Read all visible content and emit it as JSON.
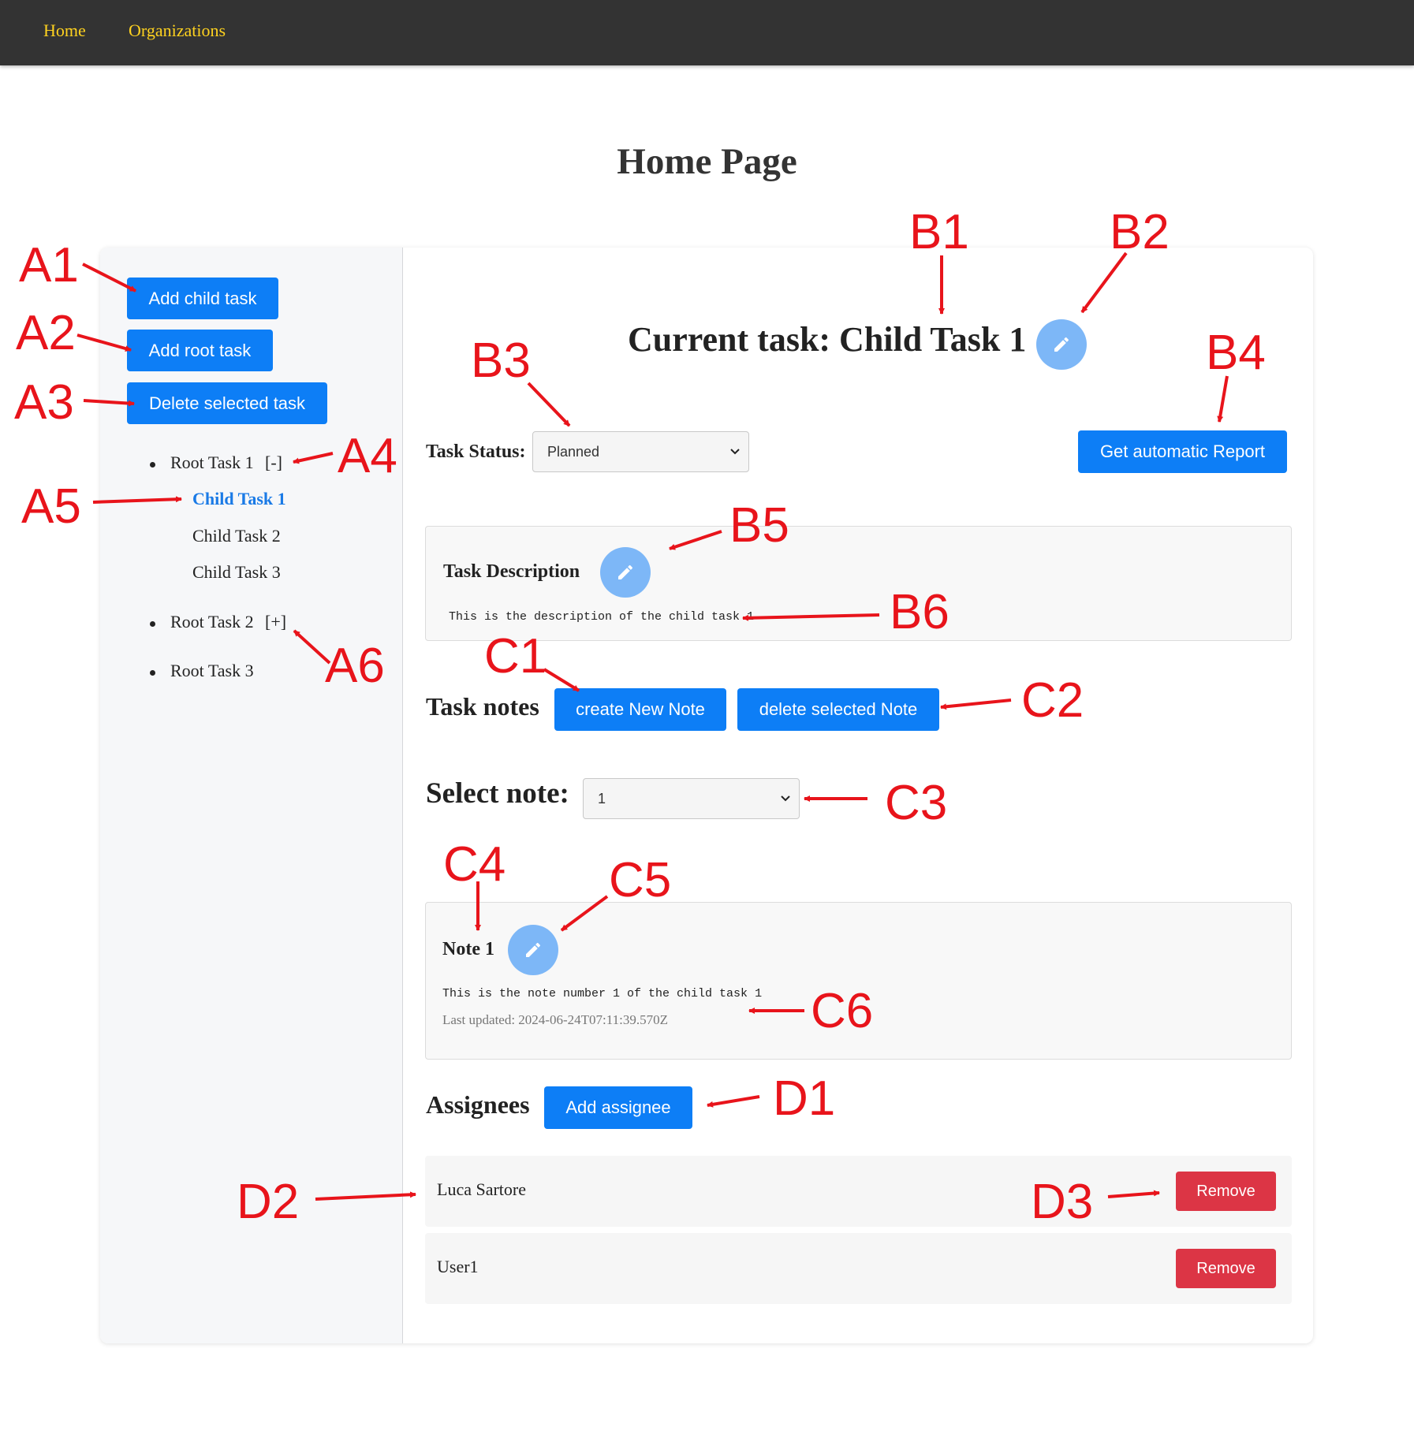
{
  "nav": {
    "home": "Home",
    "organizations": "Organizations"
  },
  "page_title": "Home Page",
  "sidebar": {
    "add_child": "Add child task",
    "add_root": "Add root task",
    "delete_selected": "Delete selected task",
    "tree": {
      "root1": "Root Task 1",
      "root1_toggle": "[-]",
      "child1": "Child Task 1",
      "child2": "Child Task 2",
      "child3": "Child Task 3",
      "root2": "Root Task 2",
      "root2_toggle": "[+]",
      "root3": "Root Task 3"
    }
  },
  "main": {
    "current_task": "Current task: Child Task 1",
    "status_label": "Task Status:",
    "status_value": "Planned",
    "report_button": "Get automatic Report",
    "description_title": "Task Description",
    "description_text": "This is the description of the child task 1",
    "notes_heading": "Task notes",
    "create_note": "create New Note",
    "delete_note": "delete selected Note",
    "select_note_label": "Select note:",
    "select_note_value": "1",
    "note_title": "Note 1",
    "note_text": "This is the note number 1 of the child task 1",
    "note_updated": "Last updated: 2024-06-24T07:11:39.570Z",
    "assignees_heading": "Assignees",
    "add_assignee": "Add assignee",
    "assignees": [
      {
        "name": "Luca Sartore",
        "remove": "Remove"
      },
      {
        "name": "User1",
        "remove": "Remove"
      }
    ]
  },
  "annotations": {
    "A1": "A1",
    "A2": "A2",
    "A3": "A3",
    "A4": "A4",
    "A5": "A5",
    "A6": "A6",
    "B1": "B1",
    "B2": "B2",
    "B3": "B3",
    "B4": "B4",
    "B5": "B5",
    "B6": "B6",
    "C1": "C1",
    "C2": "C2",
    "C3": "C3",
    "C4": "C4",
    "C5": "C5",
    "C6": "C6",
    "D1": "D1",
    "D2": "D2",
    "D3": "D3"
  },
  "colors": {
    "primary": "#0d7ef6",
    "danger": "#dc3545",
    "nav_bg": "#333333",
    "nav_link": "#ffd21f",
    "annotation": "#e8141b",
    "edit_icon_bg": "#7db7f7"
  }
}
